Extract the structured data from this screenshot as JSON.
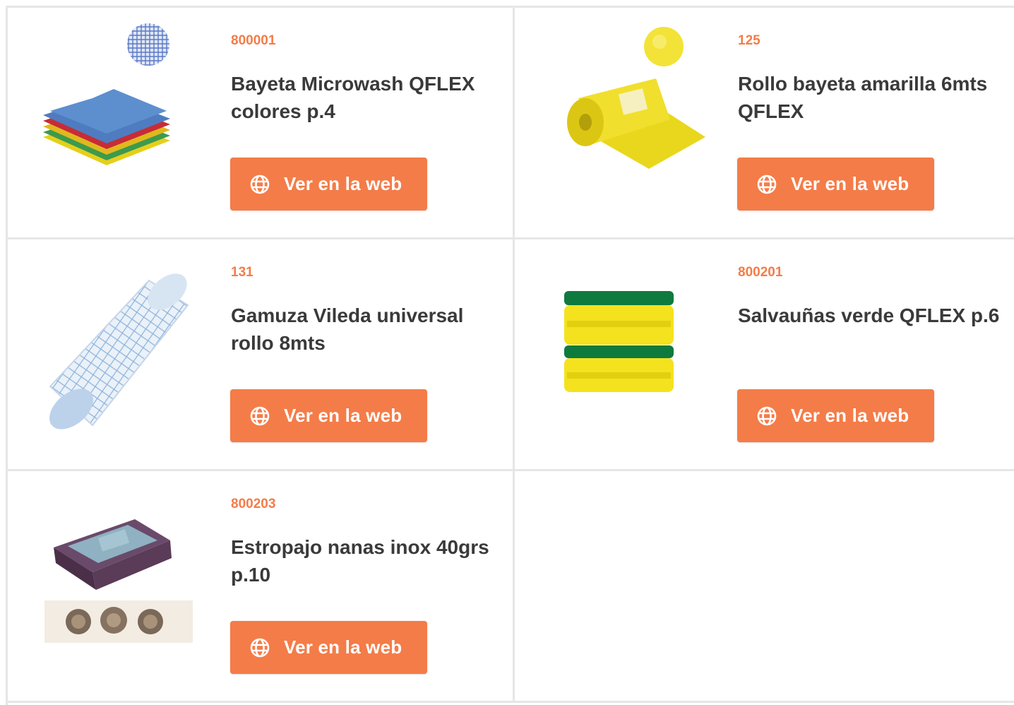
{
  "accent_color": "#f47c48",
  "button_label": "Ver en la web",
  "products": [
    {
      "code": "800001",
      "name": "Bayeta Microwash QFLEX colores p.4",
      "image": "stacked-cloths-image"
    },
    {
      "code": "125",
      "name": "Rollo bayeta amarilla 6mts QFLEX",
      "image": "yellow-roll-image"
    },
    {
      "code": "131",
      "name": "Gamuza Vileda universal rollo 8mts",
      "image": "blue-roll-image"
    },
    {
      "code": "800201",
      "name": "Salvauñas verde QFLEX p.6",
      "image": "scouring-sponges-image"
    },
    {
      "code": "800203",
      "name": "Estropajo nanas inox 40grs p.10",
      "image": "steel-wool-box-image"
    }
  ]
}
